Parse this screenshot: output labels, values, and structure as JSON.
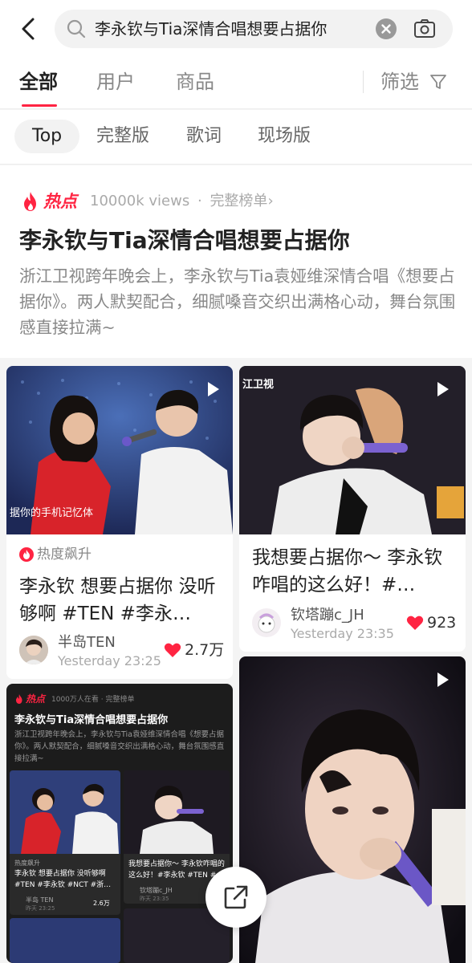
{
  "search": {
    "query": "李永钦与Tia深情合唱想要占据你"
  },
  "tabs": [
    {
      "label": "全部",
      "active": true
    },
    {
      "label": "用户"
    },
    {
      "label": "商品"
    }
  ],
  "filter_label": "筛选",
  "subtabs": [
    {
      "label": "Top",
      "active": true
    },
    {
      "label": "完整版"
    },
    {
      "label": "歌词"
    },
    {
      "label": "现场版"
    }
  ],
  "hot": {
    "tag": "热点",
    "views": "10000k views",
    "dot": "·",
    "rank_link": "完整榜单",
    "title": "李永钦与Tia深情合唱想要占据你",
    "description": "浙江卫视跨年晚会上，李永钦与Tia袁娅维深情合唱《想要占据你》。两人默契配合，细腻嗓音交织出满格心动，舞台氛围感直接拉满~"
  },
  "cards": [
    {
      "overlay_left": "据你的手机记忆体",
      "trend": "热度飙升",
      "title": "李永钦 想要占据你 没听够啊 #TEN #李永…",
      "author": "半岛TEN",
      "time": "Yesterday 23:25",
      "likes": "2.7万"
    },
    {
      "overlay_top": "江卫视",
      "title": "我想要占据你～ 李永钦咋唱的这么好！#…",
      "author": "钦塔蹦c_JH",
      "time": "Yesterday 23:35",
      "likes": "923"
    }
  ],
  "mini": {
    "tag": "热点",
    "meta": "1000万人在看 · 完整榜单",
    "title": "李永钦与Tia深情合唱想要占据你",
    "desc": "浙江卫视跨年晚会上，李永钦与Tia袁娅维深情合唱《想要占据你》。两人默契配合，细腻嗓音交织出满格心动，舞台氛围感直接拉满~",
    "c1_trend": "热度飙升",
    "c1_title": "李永钦 想要占据你 没听够啊 #TEN #李永钦 #NCT #浙…",
    "c1_author": "半岛 TEN",
    "c1_time": "昨天 23:25",
    "c1_likes": "2.6万",
    "c2_title": "我想要占据你～ 李永钦咋唱的这么好！#李永钦 #TEN #…",
    "c2_author": "钦塔蹦c_JH",
    "c2_time": "昨天 23:35"
  },
  "colors": {
    "accent": "#ff2442",
    "text": "#222222",
    "muted": "#888888",
    "bg": "#f4f4f4"
  }
}
